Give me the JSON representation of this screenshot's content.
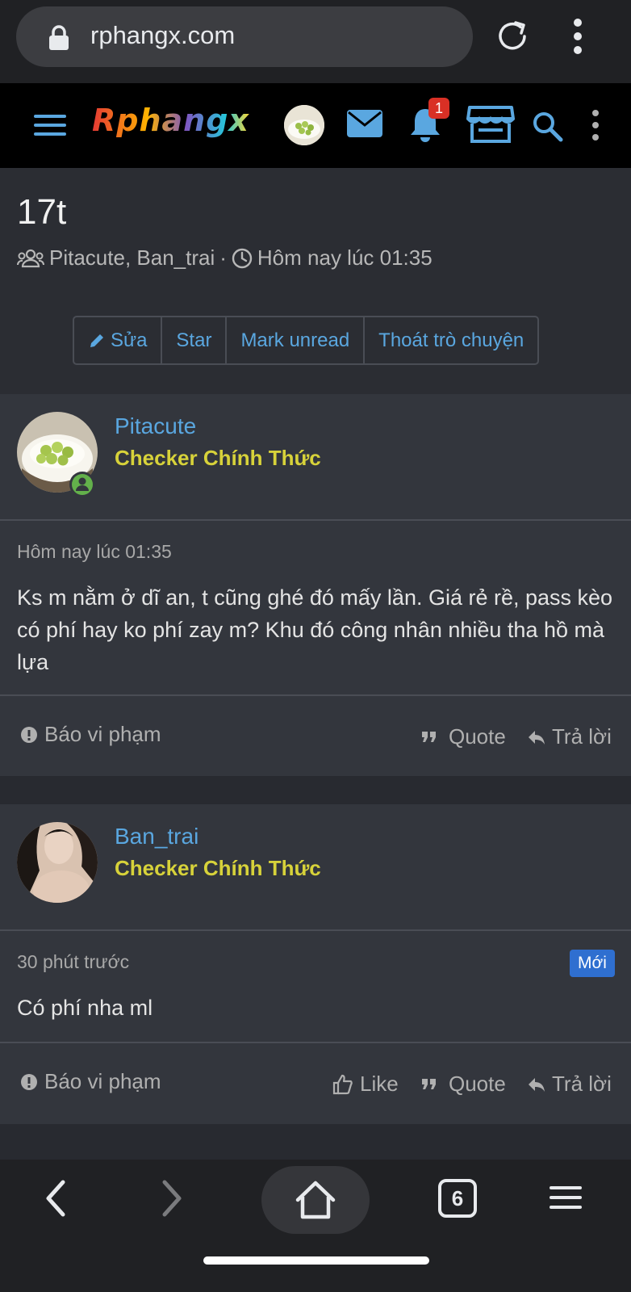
{
  "browser": {
    "url": "rphangx.com",
    "tab_count": "6"
  },
  "site": {
    "logo_text": "Rphangx",
    "notification_count": "1",
    "colors": {
      "header_bg": "#000000",
      "icon_blue": "#5aa7e0",
      "badge_red": "#d93025"
    }
  },
  "conversation": {
    "title": "17t",
    "participants": "Pitacute, Ban_trai",
    "separator": "·",
    "time": "Hôm nay lúc 01:35",
    "buttons": {
      "edit": "Sửa",
      "star": "Star",
      "mark_unread": "Mark unread",
      "leave": "Thoát trò chuyện"
    }
  },
  "messages": [
    {
      "username": "Pitacute",
      "user_title": "Checker Chính Thức",
      "online": true,
      "date": "Hôm nay lúc 01:35",
      "body": "Ks m nằm ở dĩ an, t cũng ghé đó mấy lần. Giá rẻ rề, pass kèo có phí hay ko phí zay m? Khu đó công nhân nhiều tha hồ mà lựa",
      "report": "Báo vi phạm",
      "quote": "Quote",
      "reply": "Trả lời"
    },
    {
      "username": "Ban_trai",
      "user_title": "Checker Chính Thức",
      "date": "30 phút trước",
      "new_badge": "Mới",
      "body": "Có phí nha ml",
      "report": "Báo vi phạm",
      "like": "Like",
      "quote": "Quote",
      "reply": "Trả lời"
    }
  ]
}
